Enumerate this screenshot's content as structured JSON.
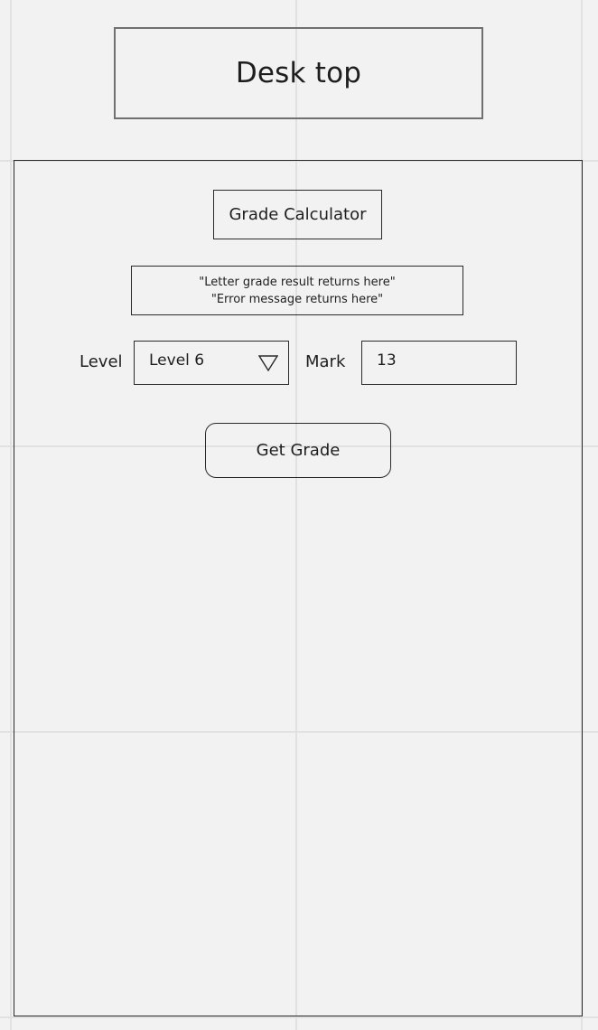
{
  "header": {
    "title": "Desk top"
  },
  "calculator": {
    "heading": "Grade Calculator",
    "messages": {
      "result_line": "\"Letter grade result returns here\"",
      "error_line": "\"Error message returns here\""
    },
    "level": {
      "label": "Level",
      "selected": "Level 6",
      "icon": "triangle-down-icon"
    },
    "mark": {
      "label": "Mark",
      "value": "13"
    },
    "submit_label": "Get Grade"
  },
  "colors": {
    "background": "#f2f2f2",
    "grid": "#e1e1e1",
    "border": "#2a2a2a",
    "title_border": "#707070",
    "text": "#1e1e1e"
  }
}
